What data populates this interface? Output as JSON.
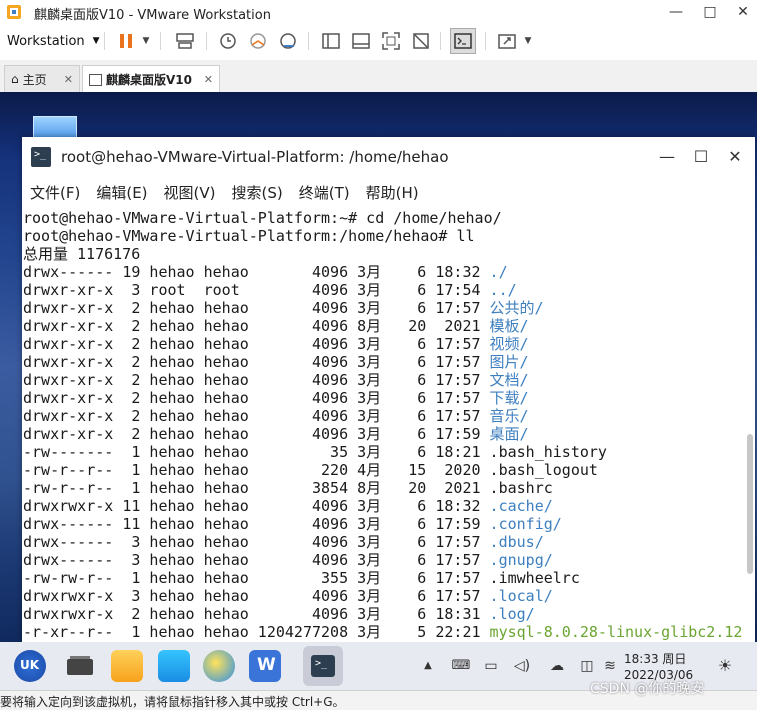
{
  "window": {
    "title": "麒麟桌面版V10 - VMware Workstation",
    "controls": [
      "—",
      "□",
      "✕"
    ]
  },
  "toolbar": {
    "workstation_label": "Workstation",
    "icons": [
      "pause-icon",
      "dropdown-icon",
      "send-keys-icon",
      "snapshot-icon",
      "revert-snapshot-icon",
      "snapshot-manager-icon",
      "show-library-icon",
      "thumbnail-bar-icon",
      "fullscreen-icon",
      "unity-icon",
      "console-view-icon",
      "stretch-view-icon",
      "dropdown-icon"
    ]
  },
  "tabs": [
    {
      "label": "主页",
      "active": false
    },
    {
      "label": "麒麟桌面版V10",
      "active": true
    }
  ],
  "terminal": {
    "title": "root@hehao-VMware-Virtual-Platform: /home/hehao",
    "menu": [
      "文件(F)",
      "编辑(E)",
      "视图(V)",
      "搜索(S)",
      "终端(T)",
      "帮助(H)"
    ],
    "lines": [
      {
        "text": "root@hehao-VMware-Virtual-Platform:~# cd /home/hehao/",
        "name": "",
        "type": "plain"
      },
      {
        "text": "root@hehao-VMware-Virtual-Platform:/home/hehao# ll",
        "name": "",
        "type": "plain"
      },
      {
        "text": "总用量 1176176",
        "name": "",
        "type": "plain"
      },
      {
        "text": "drwx------ 19 hehao hehao       4096 3月    6 18:32 ",
        "name": "./",
        "type": "dir"
      },
      {
        "text": "drwxr-xr-x  3 root  root        4096 3月    6 17:54 ",
        "name": "../",
        "type": "dir"
      },
      {
        "text": "drwxr-xr-x  2 hehao hehao       4096 3月    6 17:57 ",
        "name": "公共的/",
        "type": "dir"
      },
      {
        "text": "drwxr-xr-x  2 hehao hehao       4096 8月   20  2021 ",
        "name": "模板/",
        "type": "dir"
      },
      {
        "text": "drwxr-xr-x  2 hehao hehao       4096 3月    6 17:57 ",
        "name": "视频/",
        "type": "dir"
      },
      {
        "text": "drwxr-xr-x  2 hehao hehao       4096 3月    6 17:57 ",
        "name": "图片/",
        "type": "dir"
      },
      {
        "text": "drwxr-xr-x  2 hehao hehao       4096 3月    6 17:57 ",
        "name": "文档/",
        "type": "dir"
      },
      {
        "text": "drwxr-xr-x  2 hehao hehao       4096 3月    6 17:57 ",
        "name": "下载/",
        "type": "dir"
      },
      {
        "text": "drwxr-xr-x  2 hehao hehao       4096 3月    6 17:57 ",
        "name": "音乐/",
        "type": "dir"
      },
      {
        "text": "drwxr-xr-x  2 hehao hehao       4096 3月    6 17:59 ",
        "name": "桌面/",
        "type": "dir"
      },
      {
        "text": "-rw-------  1 hehao hehao         35 3月    6 18:21 ",
        "name": ".bash_history",
        "type": "plain"
      },
      {
        "text": "-rw-r--r--  1 hehao hehao        220 4月   15  2020 ",
        "name": ".bash_logout",
        "type": "plain"
      },
      {
        "text": "-rw-r--r--  1 hehao hehao       3854 8月   20  2021 ",
        "name": ".bashrc",
        "type": "plain"
      },
      {
        "text": "drwxrwxr-x 11 hehao hehao       4096 3月    6 18:32 ",
        "name": ".cache/",
        "type": "dir"
      },
      {
        "text": "drwx------ 11 hehao hehao       4096 3月    6 17:59 ",
        "name": ".config/",
        "type": "dir"
      },
      {
        "text": "drwx------  3 hehao hehao       4096 3月    6 17:57 ",
        "name": ".dbus/",
        "type": "dir"
      },
      {
        "text": "drwx------  3 hehao hehao       4096 3月    6 17:57 ",
        "name": ".gnupg/",
        "type": "dir"
      },
      {
        "text": "-rw-rw-r--  1 hehao hehao        355 3月    6 17:57 ",
        "name": ".imwheelrc",
        "type": "plain"
      },
      {
        "text": "drwxrwxr-x  3 hehao hehao       4096 3月    6 17:57 ",
        "name": ".local/",
        "type": "dir"
      },
      {
        "text": "drwxrwxr-x  2 hehao hehao       4096 3月    6 18:31 ",
        "name": ".log/",
        "type": "dir"
      },
      {
        "text": "-r-xr--r--  1 hehao hehao 1204277208 3月    5 22:21 ",
        "name": "mysql-8.0.28-linux-glibc2.12-",
        "type": "exe"
      }
    ]
  },
  "taskbar": {
    "apps": [
      "start-menu-icon",
      "multitask-icon",
      "file-manager-icon",
      "software-store-icon",
      "browser-icon",
      "wps-writer-icon",
      "terminal-icon"
    ],
    "tray_icons": [
      "up-arrow-icon",
      "keyboard-icon",
      "notification-icon",
      "volume-icon",
      "weather-icon",
      "network-icon",
      "wifi-icon",
      "night-mode-icon"
    ],
    "time": "18:33 周日",
    "date": "2022/03/06"
  },
  "statusbar": {
    "text": "要将输入定向到该虚拟机，请将鼠标指针移入其中或按 Ctrl+G。"
  },
  "watermark": "CSDN @你的晚安"
}
